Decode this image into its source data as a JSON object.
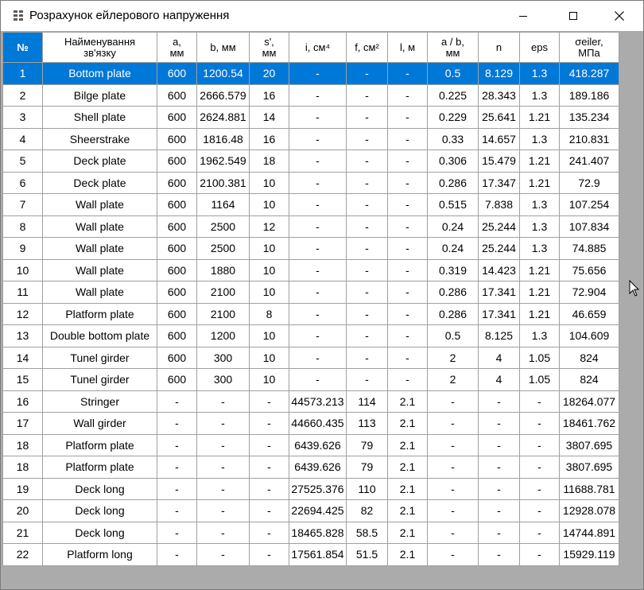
{
  "window": {
    "title": "Розрахунок ейлерового напруження",
    "icon": "grid-app-icon",
    "controls": {
      "minimize": "minimize-icon",
      "maximize": "maximize-icon",
      "close": "close-icon"
    }
  },
  "table": {
    "headers": [
      {
        "key": "num",
        "label": "№"
      },
      {
        "key": "name",
        "label": "Найменування\nзв'язку"
      },
      {
        "key": "a",
        "label": "a,\nмм"
      },
      {
        "key": "b",
        "label": "b, мм"
      },
      {
        "key": "s",
        "label": "s',\nмм"
      },
      {
        "key": "i",
        "label": "i, см⁴"
      },
      {
        "key": "f",
        "label": "f, см²"
      },
      {
        "key": "l",
        "label": "l, м"
      },
      {
        "key": "ab",
        "label": "a / b,\nмм"
      },
      {
        "key": "n",
        "label": "n"
      },
      {
        "key": "eps",
        "label": "eps"
      },
      {
        "key": "sigma",
        "label": "σeiler,\nМПа"
      }
    ],
    "selected_row": 0,
    "rows": [
      [
        "1",
        "Bottom plate",
        "600",
        "1200.54",
        "20",
        "-",
        "-",
        "-",
        "0.5",
        "8.129",
        "1.3",
        "418.287"
      ],
      [
        "2",
        "Bilge plate",
        "600",
        "2666.579",
        "16",
        "-",
        "-",
        "-",
        "0.225",
        "28.343",
        "1.3",
        "189.186"
      ],
      [
        "3",
        "Shell plate",
        "600",
        "2624.881",
        "14",
        "-",
        "-",
        "-",
        "0.229",
        "25.641",
        "1.21",
        "135.234"
      ],
      [
        "4",
        "Sheerstrake",
        "600",
        "1816.48",
        "16",
        "-",
        "-",
        "-",
        "0.33",
        "14.657",
        "1.3",
        "210.831"
      ],
      [
        "5",
        "Deck plate",
        "600",
        "1962.549",
        "18",
        "-",
        "-",
        "-",
        "0.306",
        "15.479",
        "1.21",
        "241.407"
      ],
      [
        "6",
        "Deck plate",
        "600",
        "2100.381",
        "10",
        "-",
        "-",
        "-",
        "0.286",
        "17.347",
        "1.21",
        "72.9"
      ],
      [
        "7",
        "Wall plate",
        "600",
        "1164",
        "10",
        "-",
        "-",
        "-",
        "0.515",
        "7.838",
        "1.3",
        "107.254"
      ],
      [
        "8",
        "Wall plate",
        "600",
        "2500",
        "12",
        "-",
        "-",
        "-",
        "0.24",
        "25.244",
        "1.3",
        "107.834"
      ],
      [
        "9",
        "Wall plate",
        "600",
        "2500",
        "10",
        "-",
        "-",
        "-",
        "0.24",
        "25.244",
        "1.3",
        "74.885"
      ],
      [
        "10",
        "Wall plate",
        "600",
        "1880",
        "10",
        "-",
        "-",
        "-",
        "0.319",
        "14.423",
        "1.21",
        "75.656"
      ],
      [
        "11",
        "Wall plate",
        "600",
        "2100",
        "10",
        "-",
        "-",
        "-",
        "0.286",
        "17.341",
        "1.21",
        "72.904"
      ],
      [
        "12",
        "Platform plate",
        "600",
        "2100",
        "8",
        "-",
        "-",
        "-",
        "0.286",
        "17.341",
        "1.21",
        "46.659"
      ],
      [
        "13",
        "Double bottom plate",
        "600",
        "1200",
        "10",
        "-",
        "-",
        "-",
        "0.5",
        "8.125",
        "1.3",
        "104.609"
      ],
      [
        "14",
        "Tunel girder",
        "600",
        "300",
        "10",
        "-",
        "-",
        "-",
        "2",
        "4",
        "1.05",
        "824"
      ],
      [
        "15",
        "Tunel girder",
        "600",
        "300",
        "10",
        "-",
        "-",
        "-",
        "2",
        "4",
        "1.05",
        "824"
      ],
      [
        "16",
        "Stringer",
        "-",
        "-",
        "-",
        "44573.213",
        "114",
        "2.1",
        "-",
        "-",
        "-",
        "18264.077"
      ],
      [
        "17",
        "Wall girder",
        "-",
        "-",
        "-",
        "44660.435",
        "113",
        "2.1",
        "-",
        "-",
        "-",
        "18461.762"
      ],
      [
        "18",
        "Platform plate",
        "-",
        "-",
        "-",
        "6439.626",
        "79",
        "2.1",
        "-",
        "-",
        "-",
        "3807.695"
      ],
      [
        "18",
        "Platform plate",
        "-",
        "-",
        "-",
        "6439.626",
        "79",
        "2.1",
        "-",
        "-",
        "-",
        "3807.695"
      ],
      [
        "19",
        "Deck long",
        "-",
        "-",
        "-",
        "27525.376",
        "110",
        "2.1",
        "-",
        "-",
        "-",
        "11688.781"
      ],
      [
        "20",
        "Deck long",
        "-",
        "-",
        "-",
        "22694.425",
        "82",
        "2.1",
        "-",
        "-",
        "-",
        "12928.078"
      ],
      [
        "21",
        "Deck long",
        "-",
        "-",
        "-",
        "18465.828",
        "58.5",
        "2.1",
        "-",
        "-",
        "-",
        "14744.891"
      ],
      [
        "22",
        "Platform long",
        "-",
        "-",
        "-",
        "17561.854",
        "51.5",
        "2.1",
        "-",
        "-",
        "-",
        "15929.119"
      ]
    ]
  },
  "colors": {
    "selection": "#0078d7",
    "client_background": "#ababab",
    "grid_line": "#a0a0a0"
  }
}
